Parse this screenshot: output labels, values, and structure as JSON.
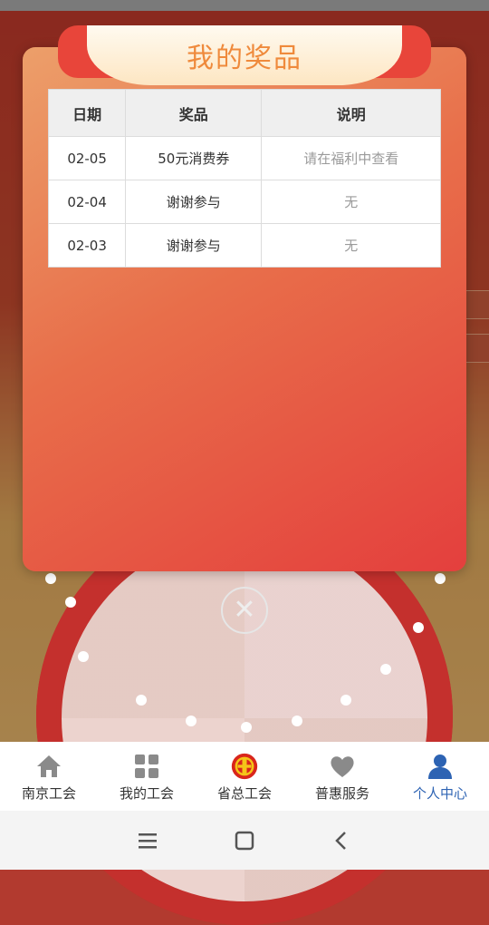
{
  "modal": {
    "title": "我的奖品",
    "columns": [
      "日期",
      "奖品",
      "说明"
    ],
    "rows": [
      {
        "date": "02-05",
        "prize": "50元消费券",
        "note": "请在福利中查看"
      },
      {
        "date": "02-04",
        "prize": "谢谢参与",
        "note": "无"
      },
      {
        "date": "02-03",
        "prize": "谢谢参与",
        "note": "无"
      }
    ],
    "close_symbol": "✕"
  },
  "tabbar": {
    "items": [
      {
        "label": "南京工会",
        "icon": "home-icon"
      },
      {
        "label": "我的工会",
        "icon": "grid-icon"
      },
      {
        "label": "省总工会",
        "icon": "union-emblem-icon"
      },
      {
        "label": "普惠服务",
        "icon": "heart-hands-icon"
      },
      {
        "label": "个人中心",
        "icon": "person-icon"
      }
    ],
    "active_index": 4,
    "active_color": "#2d63b3"
  },
  "system_nav": {
    "icons": [
      "recent-apps-icon",
      "home-square-icon",
      "back-icon"
    ]
  }
}
